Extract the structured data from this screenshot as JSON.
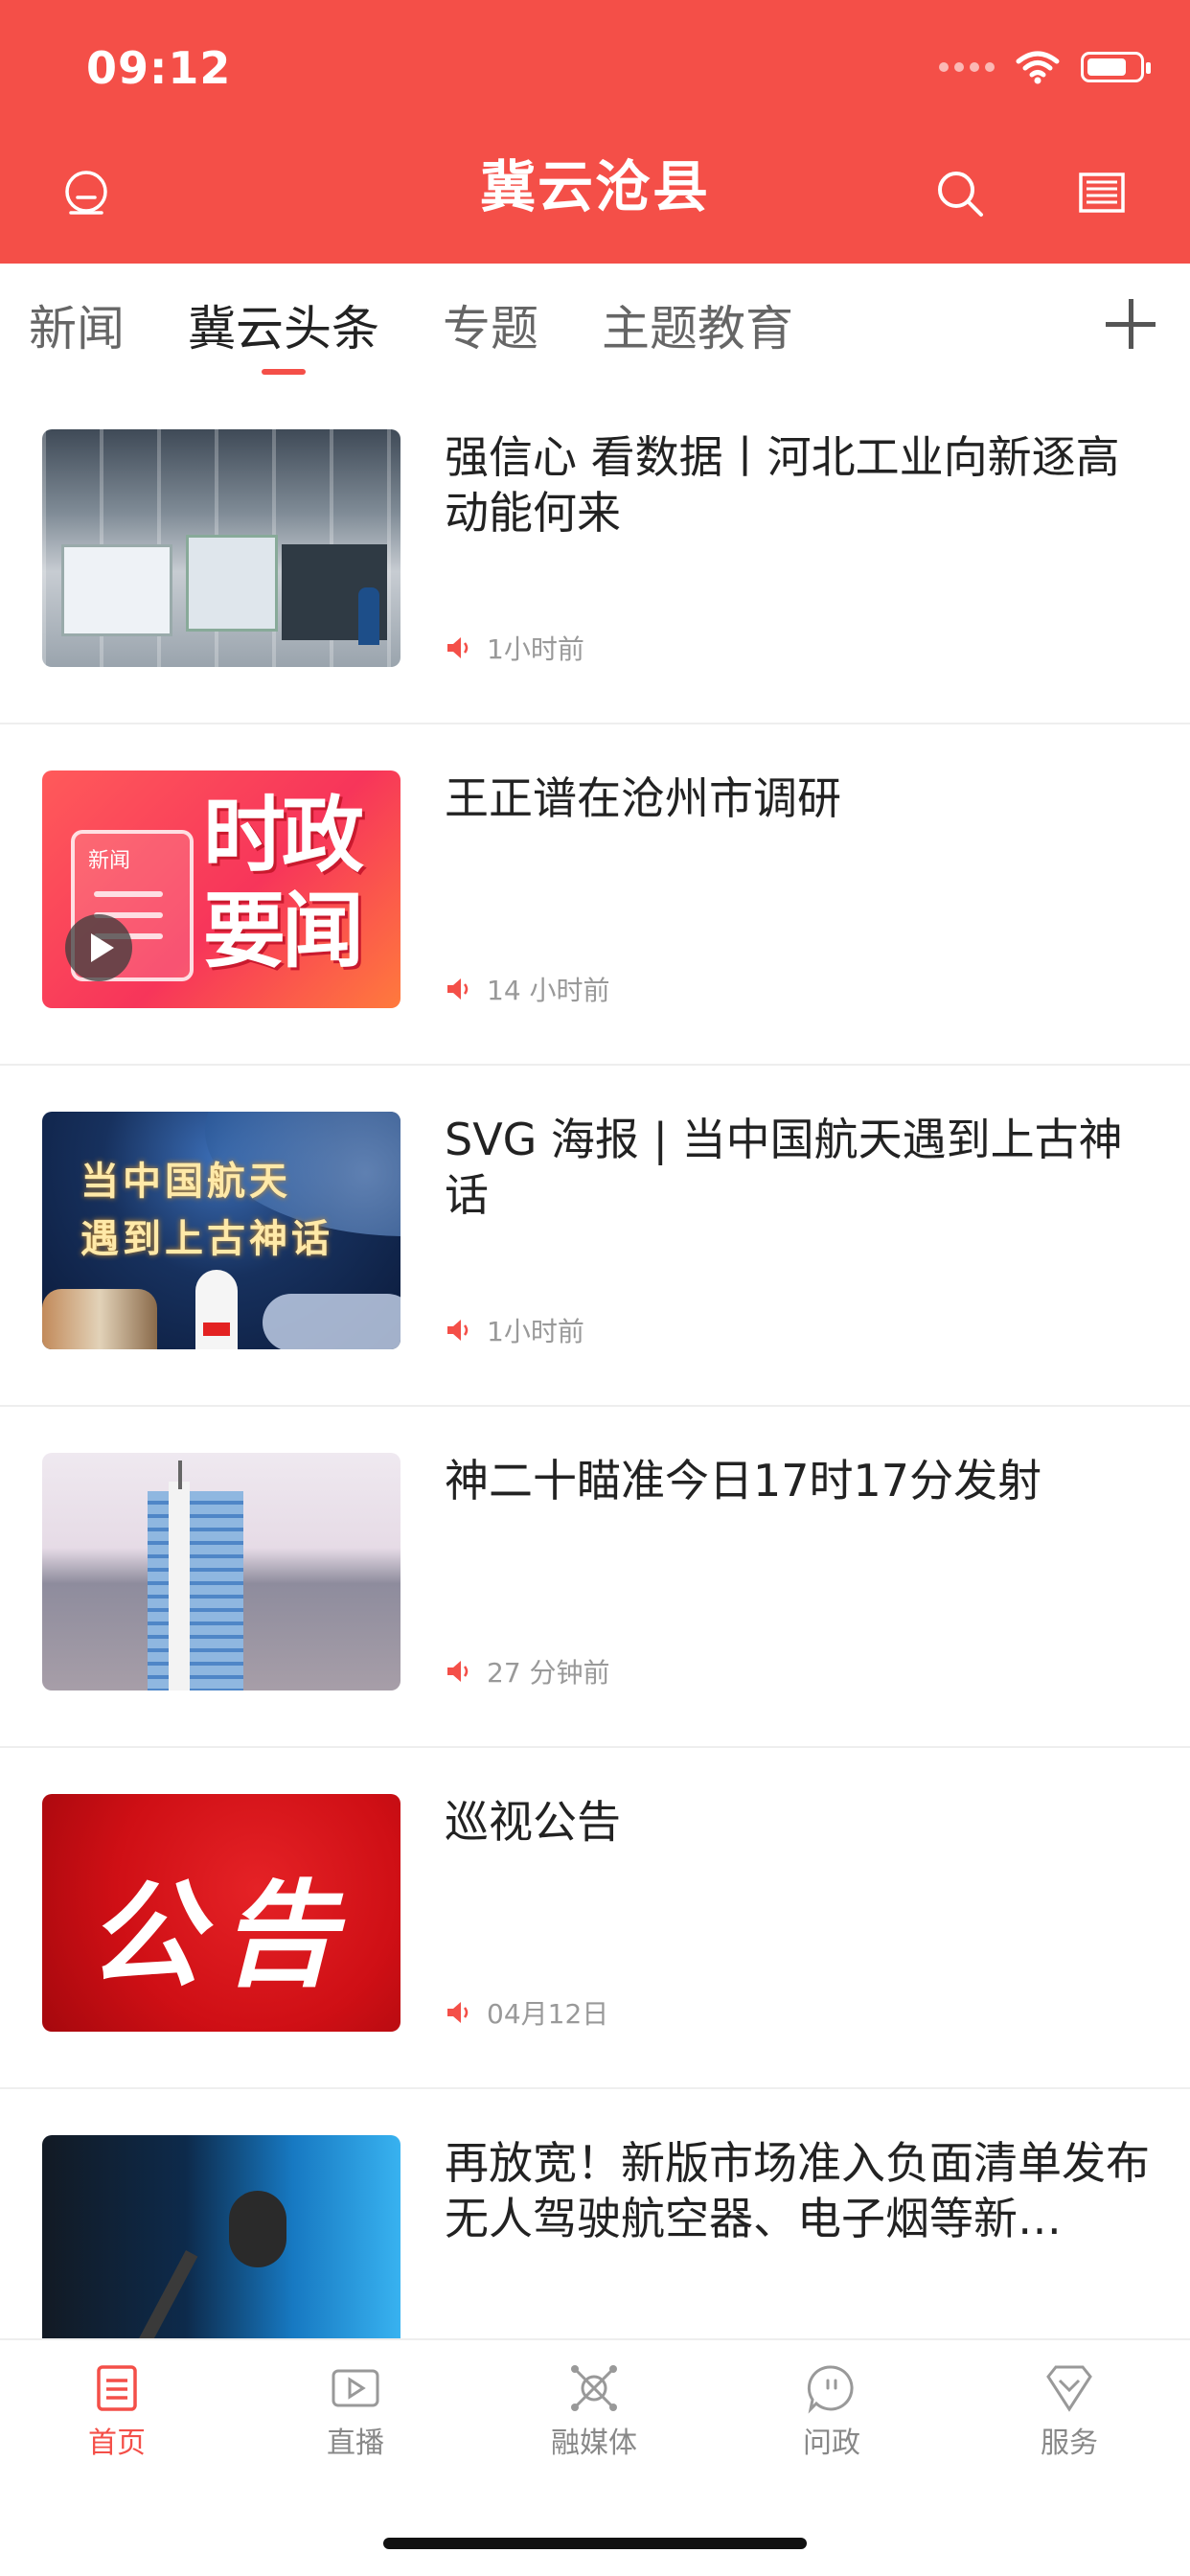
{
  "status_bar": {
    "time": "09:12"
  },
  "header": {
    "title": "冀云沧县",
    "bg_color": "#f44f48"
  },
  "tabs": [
    {
      "label": "新闻",
      "active": false
    },
    {
      "label": "冀云头条",
      "active": true
    },
    {
      "label": "专题",
      "active": false
    },
    {
      "label": "主题教育",
      "active": false
    }
  ],
  "feed": [
    {
      "title": "强信心 看数据丨河北工业向新逐高动能何来",
      "time": "1小时前",
      "thumb": "factory-photo"
    },
    {
      "title": "王正谱在沧州市调研",
      "time": "14 小时前",
      "thumb": "politics-graphic",
      "thumb_text_small": "新闻",
      "thumb_text_big": "时政要闻"
    },
    {
      "title": "SVG 海报 | 当中国航天遇到上古神话",
      "time": "1小时前",
      "thumb": "space-poster",
      "thumb_line1": "当中国航天",
      "thumb_line2": "遇到上古神话"
    },
    {
      "title": "神二十瞄准今日17时17分发射",
      "time": "27 分钟前",
      "thumb": "launch-tower"
    },
    {
      "title": "巡视公告",
      "time": "04月12日",
      "thumb": "notice-red",
      "thumb_text": "公告"
    },
    {
      "title": "再放宽！新版市场准入负面清单发布 无人驾驶航空器、电子烟等新…",
      "time": "",
      "thumb": "microphone"
    }
  ],
  "tabbar": [
    {
      "label": "首页",
      "icon": "home-doc-icon",
      "active": true
    },
    {
      "label": "直播",
      "icon": "video-icon",
      "active": false
    },
    {
      "label": "融媒体",
      "icon": "media-hub-icon",
      "active": false
    },
    {
      "label": "问政",
      "icon": "chat-bubble-icon",
      "active": false
    },
    {
      "label": "服务",
      "icon": "service-heart-icon",
      "active": false
    }
  ],
  "colors": {
    "accent": "#f44f48",
    "text": "#222222",
    "muted": "#999999"
  }
}
